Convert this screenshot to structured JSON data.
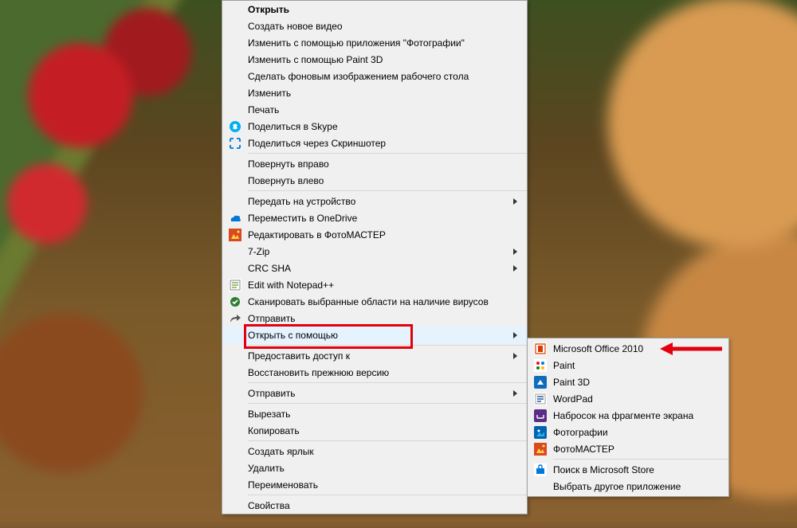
{
  "contextMenu": {
    "items": [
      {
        "label": "Открыть",
        "bold": true,
        "icon": null,
        "arrow": false
      },
      {
        "label": "Создать новое видео",
        "icon": null,
        "arrow": false
      },
      {
        "label": "Изменить с помощью приложения \"Фотографии\"",
        "icon": null,
        "arrow": false
      },
      {
        "label": "Изменить с помощью Paint 3D",
        "icon": null,
        "arrow": false
      },
      {
        "label": "Сделать фоновым изображением рабочего стола",
        "icon": null,
        "arrow": false
      },
      {
        "label": "Изменить",
        "icon": null,
        "arrow": false
      },
      {
        "label": "Печать",
        "icon": null,
        "arrow": false
      },
      {
        "label": "Поделиться в Skype",
        "icon": "skype-icon",
        "arrow": false
      },
      {
        "label": "Поделиться через Скриншотер",
        "icon": "screenshot-icon",
        "arrow": false
      },
      {
        "sep": true
      },
      {
        "label": "Повернуть вправо",
        "icon": null,
        "arrow": false
      },
      {
        "label": "Повернуть влево",
        "icon": null,
        "arrow": false
      },
      {
        "sep": true
      },
      {
        "label": "Передать на устройство",
        "icon": null,
        "arrow": true
      },
      {
        "label": "Переместить в OneDrive",
        "icon": "onedrive-icon",
        "arrow": false
      },
      {
        "label": "Редактировать в ФотоМАСТЕР",
        "icon": "fotomaster-icon",
        "arrow": false
      },
      {
        "label": "7-Zip",
        "icon": null,
        "arrow": true
      },
      {
        "label": "CRC SHA",
        "icon": null,
        "arrow": true
      },
      {
        "label": "Edit with Notepad++",
        "icon": "notepad-icon",
        "arrow": false
      },
      {
        "label": "Сканировать выбранные области на наличие вирусов",
        "icon": "scan-icon",
        "arrow": false
      },
      {
        "label": "Отправить",
        "icon": "share-icon",
        "arrow": false
      },
      {
        "label": "Открыть с помощью",
        "icon": null,
        "arrow": true,
        "hovered": true,
        "highlight": true
      },
      {
        "sep": true
      },
      {
        "label": "Предоставить доступ к",
        "icon": null,
        "arrow": true
      },
      {
        "label": "Восстановить прежнюю версию",
        "icon": null,
        "arrow": false
      },
      {
        "sep": true
      },
      {
        "label": "Отправить",
        "icon": null,
        "arrow": true
      },
      {
        "sep": true
      },
      {
        "label": "Вырезать",
        "icon": null,
        "arrow": false
      },
      {
        "label": "Копировать",
        "icon": null,
        "arrow": false
      },
      {
        "sep": true
      },
      {
        "label": "Создать ярлык",
        "icon": null,
        "arrow": false
      },
      {
        "label": "Удалить",
        "icon": null,
        "arrow": false
      },
      {
        "label": "Переименовать",
        "icon": null,
        "arrow": false
      },
      {
        "sep": true
      },
      {
        "label": "Свойства",
        "icon": null,
        "arrow": false
      }
    ]
  },
  "submenu": {
    "items": [
      {
        "label": "Microsoft Office 2010",
        "icon": "msoffice-icon",
        "callout": true
      },
      {
        "label": "Paint",
        "icon": "paint-icon"
      },
      {
        "label": "Paint 3D",
        "icon": "paint3d-icon"
      },
      {
        "label": "WordPad",
        "icon": "wordpad-icon"
      },
      {
        "label": "Набросок на фрагменте экрана",
        "icon": "snip-icon"
      },
      {
        "label": "Фотографии",
        "icon": "photos-icon"
      },
      {
        "label": "ФотоМАСТЕР",
        "icon": "fotomaster-icon"
      },
      {
        "sep": true
      },
      {
        "label": "Поиск в Microsoft Store",
        "icon": "store-icon"
      },
      {
        "label": "Выбрать другое приложение",
        "icon": null
      }
    ]
  },
  "colors": {
    "highlight": "#e3000f"
  }
}
